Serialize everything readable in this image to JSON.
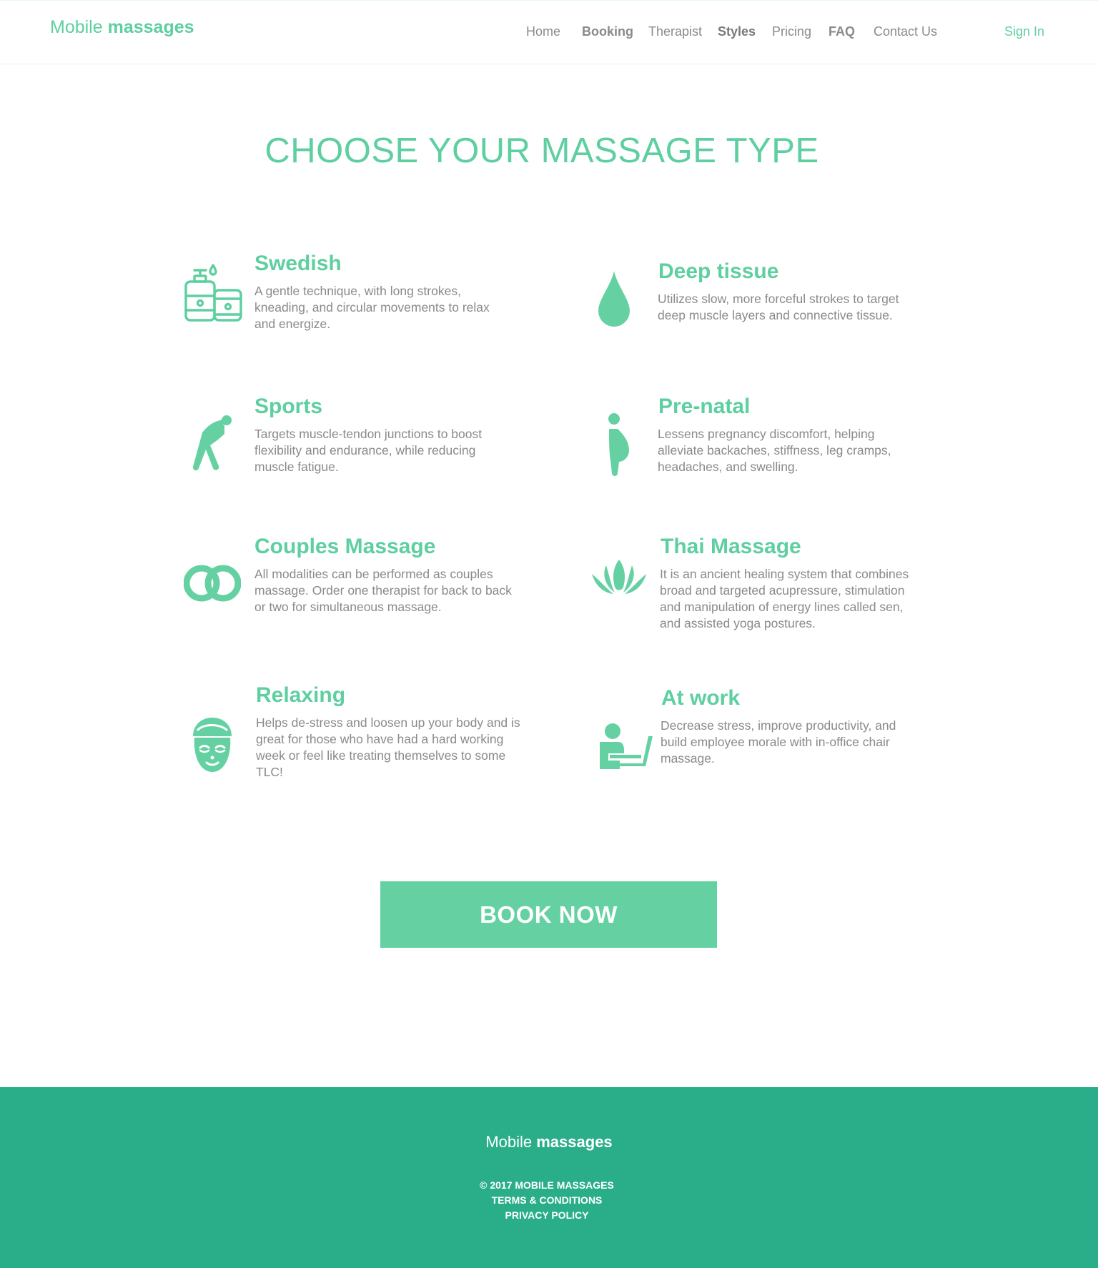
{
  "header": {
    "logo_light": "Mobile",
    "logo_bold": "massages",
    "nav": [
      {
        "label": "Home"
      },
      {
        "label": "Booking"
      },
      {
        "label": "Therapist"
      },
      {
        "label": "Styles"
      },
      {
        "label": "Pricing"
      },
      {
        "label": "FAQ"
      },
      {
        "label": "Contact Us"
      }
    ],
    "sign_in": "Sign In"
  },
  "main": {
    "title": "CHOOSE YOUR MASSAGE TYPE",
    "types": [
      {
        "name": "Swedish",
        "icon": "lotion-bottles-icon",
        "description": "A gentle technique, with long strokes, kneading, and circular movements to relax and energize."
      },
      {
        "name": "Deep tissue",
        "icon": "oil-drop-icon",
        "description": "Utilizes slow, more forceful strokes to target deep muscle layers and connective tissue."
      },
      {
        "name": "Sports",
        "icon": "stretching-person-icon",
        "description": "Targets muscle-tendon junctions to boost flexibility and endurance, while reducing muscle fatigue."
      },
      {
        "name": "Pre-natal",
        "icon": "pregnant-woman-icon",
        "description": "Lessens pregnancy discomfort, helping alleviate backaches, stiffness, leg cramps, headaches, and swelling."
      },
      {
        "name": "Couples Massage",
        "icon": "interlocked-rings-icon",
        "description": "All modalities can be performed as couples massage. Order one therapist for back to back or two for simultaneous massage."
      },
      {
        "name": "Thai Massage",
        "icon": "lotus-icon",
        "description": "It is an ancient healing system that combines broad and targeted acupressure, stimulation and manipulation of energy lines called sen, and assisted yoga postures."
      },
      {
        "name": "Relaxing",
        "icon": "face-mask-towel-icon",
        "description": "Helps de-stress and loosen up your body and is great for those who have had a hard working week or feel like treating themselves to some TLC!"
      },
      {
        "name": "At work",
        "icon": "person-at-laptop-icon",
        "description": "Decrease stress, improve productivity, and build employee morale with in-office chair massage."
      }
    ],
    "book_now": "BOOK NOW"
  },
  "footer": {
    "logo_light": "Mobile",
    "logo_bold": "massages",
    "copyright": "© 2017 MOBILE MASSAGES",
    "terms": "TERMS & CONDITIONS",
    "privacy": "PRIVACY POLICY"
  },
  "colors": {
    "accent": "#5ecfa0",
    "button": "#65d1a2",
    "footer": "#2aae8a",
    "body_text": "#8a8a8a"
  }
}
